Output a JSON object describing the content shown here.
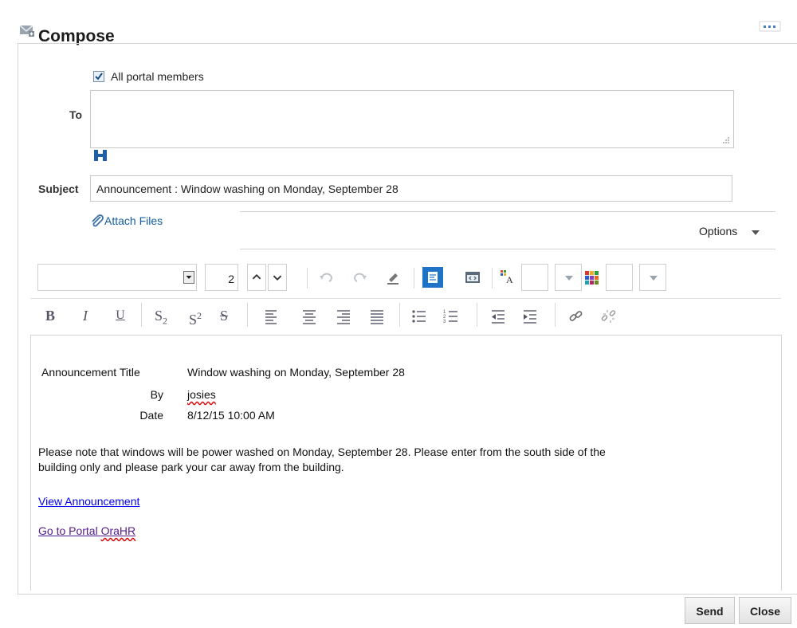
{
  "header": {
    "title": "Compose",
    "more_icon": "more-dots-icon",
    "title_icon": "compose-mail-icon"
  },
  "recipients": {
    "all_members_label": "All portal members",
    "all_members_checked": true,
    "to_label": "To",
    "to_value": ""
  },
  "subject": {
    "label": "Subject",
    "value": "Announcement : Window washing on Monday, September 28"
  },
  "attach": {
    "label": "Attach Files",
    "icon": "paperclip-icon"
  },
  "options": {
    "label": "Options"
  },
  "toolbar": {
    "font_value": "",
    "size_value": "2"
  },
  "editor": {
    "fields": [
      {
        "label": "Announcement Title",
        "value": "Window washing on Monday, September 28"
      },
      {
        "label": "By",
        "value": "josies"
      },
      {
        "label": "Date",
        "value": "8/12/15 10:00 AM"
      }
    ],
    "body_line1": "Please note that windows will be power washed on Monday, September 28. Please enter from the south side of the",
    "body_line2": "building only and please park your car away from the building.",
    "link_view": "View Announcement",
    "link_portal_prefix": "Go to Portal ",
    "link_portal_name": "OraHR"
  },
  "buttons": {
    "send": "Send",
    "close": "Close"
  },
  "colors": {
    "accent": "#1e73c7",
    "link": "#0000ee",
    "visited_link": "#551a8b"
  }
}
